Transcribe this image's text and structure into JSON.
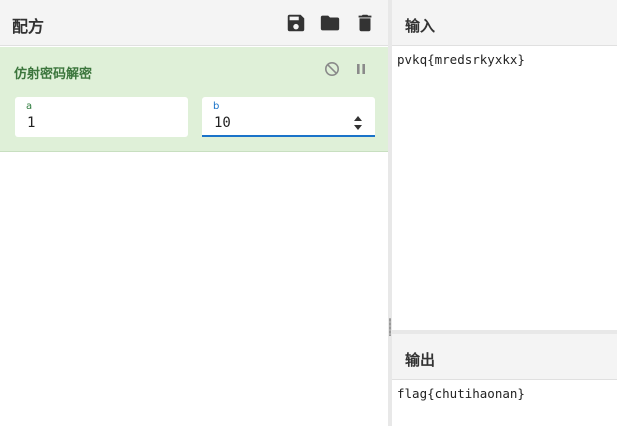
{
  "recipe": {
    "title": "配方",
    "icons": [
      "save-icon",
      "folder-icon",
      "trash-icon"
    ],
    "operation": {
      "title": "仿射密码解密",
      "icons": [
        "disable-icon",
        "pause-icon"
      ],
      "args": [
        {
          "label": "a",
          "value": "1"
        },
        {
          "label": "b",
          "value": "10"
        }
      ]
    }
  },
  "input": {
    "title": "输入",
    "text": "pvkq{mredsrkyxkx}"
  },
  "output": {
    "title": "输出",
    "text": "flag{chutihaonan}"
  },
  "colors": {
    "operation_bg": "#dff0d8",
    "operation_title": "#3c763d",
    "focus_accent": "#1a73c9"
  }
}
